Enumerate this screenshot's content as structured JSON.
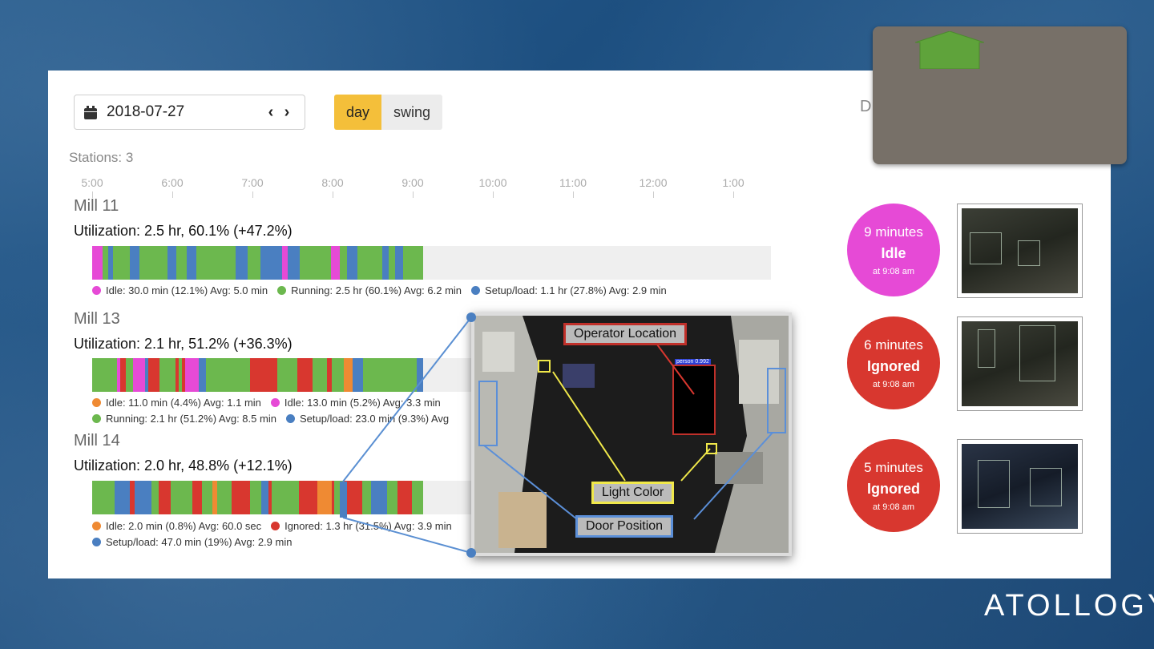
{
  "toolbar": {
    "date": "2018-07-27",
    "prev_label": "‹",
    "next_label": "›",
    "shifts": [
      "day",
      "swing"
    ],
    "active_shift": "day",
    "cut_label": "D"
  },
  "stations_label": "Stations: 3",
  "time_axis": [
    "5:00",
    "6:00",
    "7:00",
    "8:00",
    "9:00",
    "10:00",
    "11:00",
    "12:00",
    "1:00"
  ],
  "colors": {
    "idle_pink": "#e64ad6",
    "idle_orange": "#ef8a33",
    "running": "#6cb84e",
    "setup": "#4a7fc1",
    "ignored": "#d8372f",
    "shift_active": "#f4bf3a",
    "callout_bg": "#777068",
    "home_green": "#5fa33b"
  },
  "mills": [
    {
      "name": "Mill 11",
      "utilization": "Utilization: 2.5 hr, 60.1% (+47.2%)",
      "legend_rows": [
        [
          {
            "color": "#e64ad6",
            "text": "Idle: 30.0 min (12.1%) Avg: 5.0 min"
          },
          {
            "color": "#6cb84e",
            "text": "Running: 2.5 hr (60.1%) Avg: 6.2 min"
          },
          {
            "color": "#4a7fc1",
            "text": "Setup/load: 1.1 hr (27.8%) Avg: 2.9 min"
          }
        ]
      ]
    },
    {
      "name": "Mill 13",
      "utilization": "Utilization: 2.1 hr, 51.2% (+36.3%)",
      "legend_rows": [
        [
          {
            "color": "#ef8a33",
            "text": "Idle: 11.0 min (4.4%) Avg: 1.1 min"
          },
          {
            "color": "#e64ad6",
            "text": "Idle: 13.0 min (5.2%) Avg: 3.3 min"
          }
        ],
        [
          {
            "color": "#6cb84e",
            "text": "Running: 2.1 hr (51.2%) Avg: 8.5 min"
          },
          {
            "color": "#4a7fc1",
            "text": "Setup/load: 23.0 min (9.3%) Avg"
          }
        ]
      ]
    },
    {
      "name": "Mill 14",
      "utilization": "Utilization: 2.0 hr, 48.8% (+12.1%)",
      "legend_rows": [
        [
          {
            "color": "#ef8a33",
            "text": "Idle: 2.0 min (0.8%) Avg: 60.0 sec"
          },
          {
            "color": "#d8372f",
            "text": "Ignored: 1.3 hr (31.5%) Avg: 3.9 min"
          }
        ],
        [
          {
            "color": "#4a7fc1",
            "text": "Setup/load: 47.0 min (19%) Avg: 2.9 min"
          }
        ]
      ]
    }
  ],
  "alerts": [
    {
      "minutes": "9 minutes",
      "status": "Idle",
      "time": "at 9:08 am",
      "color": "#e64ad6"
    },
    {
      "minutes": "6 minutes",
      "status": "Ignored",
      "time": "at 9:08 am",
      "color": "#d8372f"
    },
    {
      "minutes": "5 minutes",
      "status": "Ignored",
      "time": "at 9:08 am",
      "color": "#d8372f"
    }
  ],
  "overlay_labels": {
    "operator": "Operator Location",
    "light": "Light Color",
    "door": "Door Position",
    "detection": "person 0.992"
  },
  "brand": "ATOLLOGY"
}
